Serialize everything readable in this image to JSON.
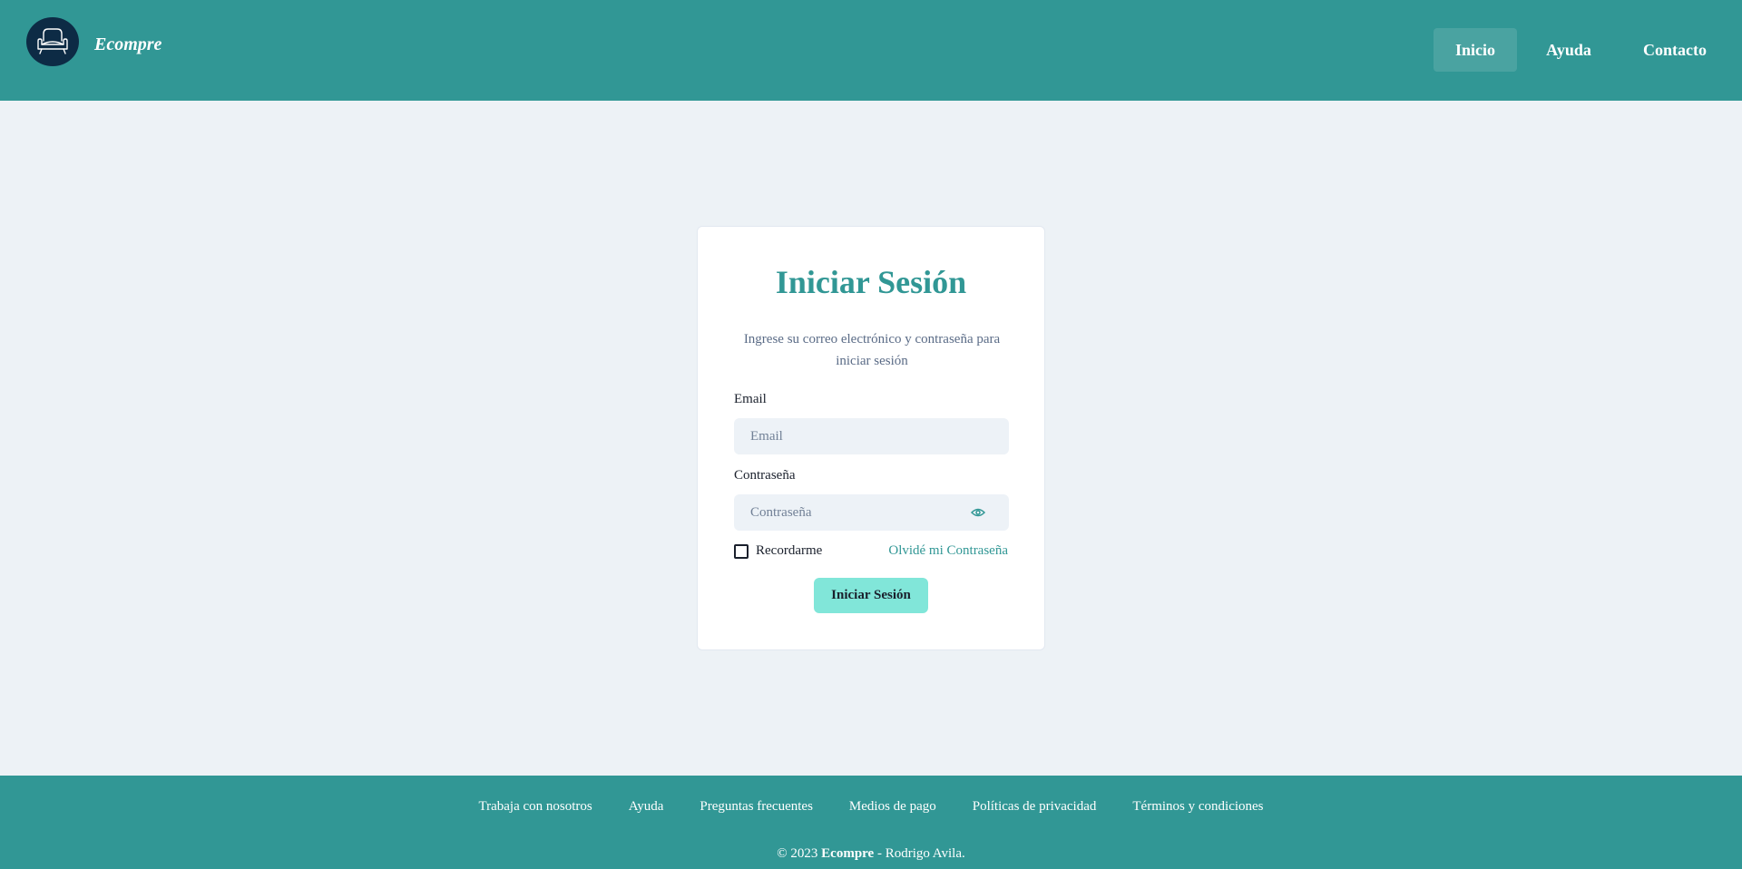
{
  "brand": {
    "name": "Ecompre",
    "logo_icon": "armchair-icon"
  },
  "nav": [
    {
      "label": "Inicio",
      "active": true
    },
    {
      "label": "Ayuda",
      "active": false
    },
    {
      "label": "Contacto",
      "active": false
    }
  ],
  "login": {
    "title": "Iniciar Sesión",
    "subtitle": "Ingrese su correo electrónico y contraseña para iniciar sesión",
    "email_label": "Email",
    "email_placeholder": "Email",
    "password_label": "Contraseña",
    "password_placeholder": "Contraseña",
    "password_toggle_icon": "eye-icon",
    "remember_label": "Recordarme",
    "remember_checked": false,
    "forgot_label": "Olvidé mi Contraseña",
    "submit_label": "Iniciar Sesión"
  },
  "footer": {
    "links": [
      "Trabaja con nosotros",
      "Ayuda",
      "Preguntas frecuentes",
      "Medios de pago",
      "Políticas de privacidad",
      "Términos y condiciones"
    ],
    "copyright_prefix": "© 2023",
    "copyright_brand": "Ecompre",
    "copyright_suffix": "- Rodrigo Avila."
  },
  "colors": {
    "primary": "#319795",
    "accent_button": "#81e6d9",
    "background": "#edf2f6",
    "logo_bg": "#0d2b45"
  }
}
